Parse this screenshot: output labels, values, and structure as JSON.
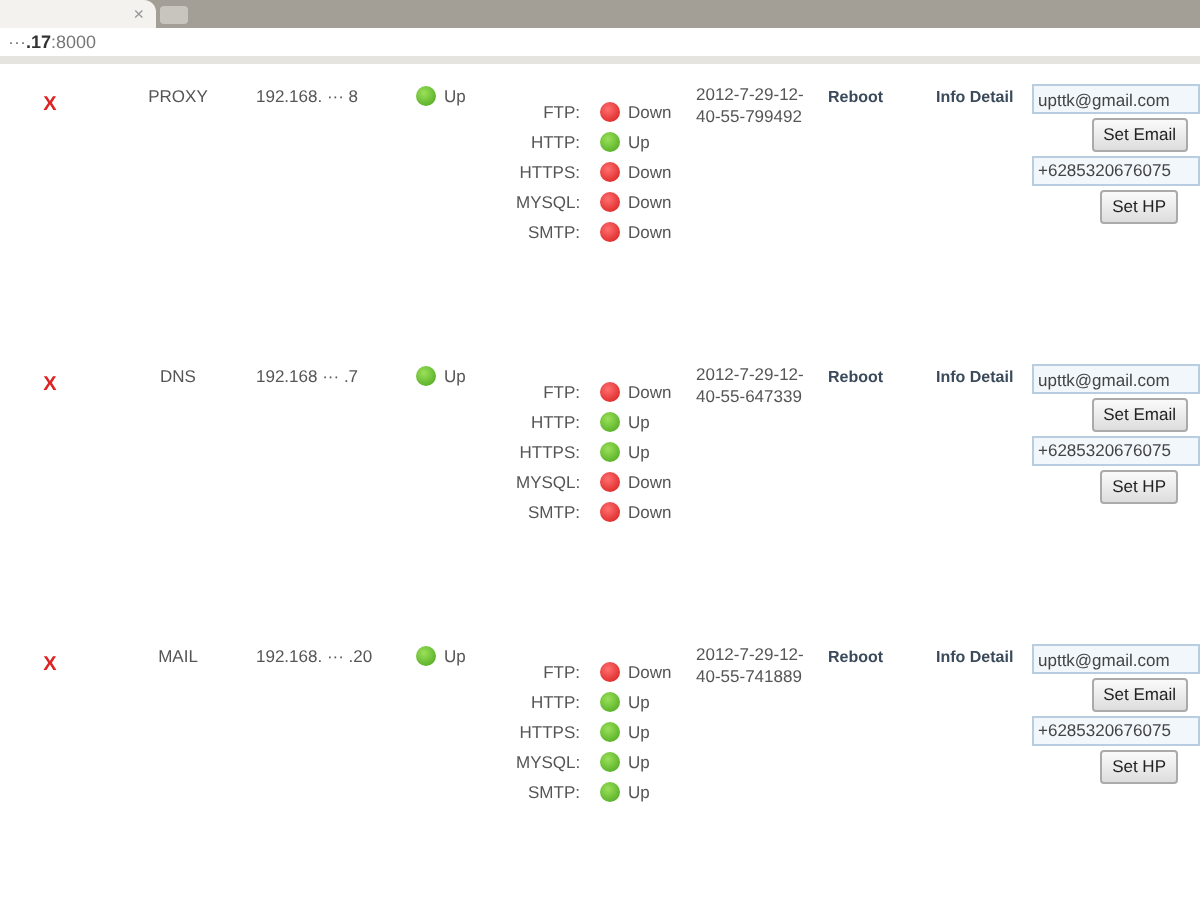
{
  "browser": {
    "tab_close": "×",
    "address": "···**.17**:8000"
  },
  "servers": [
    {
      "delete": "X",
      "name": "PROXY",
      "ip": "192.168. ··· 8",
      "status": {
        "up": true,
        "text": "Up"
      },
      "services": [
        {
          "label": "FTP:",
          "up": false,
          "text": "Down"
        },
        {
          "label": "HTTP:",
          "up": true,
          "text": "Up"
        },
        {
          "label": "HTTPS:",
          "up": false,
          "text": "Down"
        },
        {
          "label": "MYSQL:",
          "up": false,
          "text": "Down"
        },
        {
          "label": "SMTP:",
          "up": false,
          "text": "Down"
        }
      ],
      "timestamp": "2012-7-29-12-40-55-799492",
      "reboot": "Reboot",
      "info": "Info Detail",
      "email": "upttk@gmail.com",
      "set_email": "Set Email",
      "phone": "+6285320676075",
      "set_phone": "Set HP"
    },
    {
      "delete": "X",
      "name": "DNS",
      "ip": "192.168 ··· .7",
      "status": {
        "up": true,
        "text": "Up"
      },
      "services": [
        {
          "label": "FTP:",
          "up": false,
          "text": "Down"
        },
        {
          "label": "HTTP:",
          "up": true,
          "text": "Up"
        },
        {
          "label": "HTTPS:",
          "up": true,
          "text": "Up"
        },
        {
          "label": "MYSQL:",
          "up": false,
          "text": "Down"
        },
        {
          "label": "SMTP:",
          "up": false,
          "text": "Down"
        }
      ],
      "timestamp": "2012-7-29-12-40-55-647339",
      "reboot": "Reboot",
      "info": "Info Detail",
      "email": "upttk@gmail.com",
      "set_email": "Set Email",
      "phone": "+6285320676075",
      "set_phone": "Set HP"
    },
    {
      "delete": "X",
      "name": "MAIL",
      "ip": "192.168. ··· .20",
      "status": {
        "up": true,
        "text": "Up"
      },
      "services": [
        {
          "label": "FTP:",
          "up": false,
          "text": "Down"
        },
        {
          "label": "HTTP:",
          "up": true,
          "text": "Up"
        },
        {
          "label": "HTTPS:",
          "up": true,
          "text": "Up"
        },
        {
          "label": "MYSQL:",
          "up": true,
          "text": "Up"
        },
        {
          "label": "SMTP:",
          "up": true,
          "text": "Up"
        }
      ],
      "timestamp": "2012-7-29-12-40-55-741889",
      "reboot": "Reboot",
      "info": "Info Detail",
      "email": "upttk@gmail.com",
      "set_email": "Set Email",
      "phone": "+6285320676075",
      "set_phone": "Set HP"
    }
  ]
}
